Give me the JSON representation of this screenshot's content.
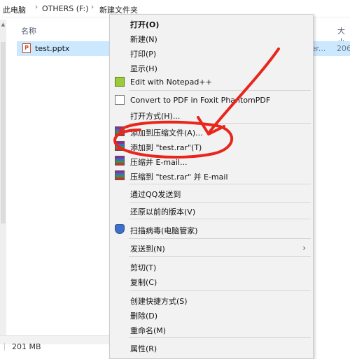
{
  "breadcrumb": [
    "此电脑",
    "OTHERS (F:)",
    "新建文件夹"
  ],
  "columns": {
    "name": "名称",
    "size": "大小"
  },
  "file": {
    "name": "test.pptx",
    "type_partial": "ver...",
    "size_partial": "206"
  },
  "status": {
    "size": "201 MB"
  },
  "context_menu": {
    "open": "打开(O)",
    "new": "新建(N)",
    "print": "打印(P)",
    "show": "显示(H)",
    "notepadpp": "Edit with Notepad++",
    "foxit": "Convert to PDF in Foxit PhantomPDF",
    "open_with": "打开方式(H)...",
    "add_to_archive": "添加到压缩文件(A)...",
    "add_to_rar": "添加到 \"test.rar\"(T)",
    "compress_email": "压缩并 E-mail...",
    "compress_rar_email": "压缩到 \"test.rar\" 并 E-mail",
    "qq_send": "通过QQ发送到",
    "restore_prev": "还原以前的版本(V)",
    "scan_virus": "扫描病毒(电脑管家)",
    "send_to": "发送到(N)",
    "cut": "剪切(T)",
    "copy": "复制(C)",
    "create_shortcut": "创建快捷方式(S)",
    "delete": "删除(D)",
    "rename": "重命名(M)",
    "properties": "属性(R)"
  },
  "annotation": {
    "color": "#e8261c",
    "shape": "hand-drawn arrow circling menu item"
  },
  "icons": {
    "notepadpp": "notepad-plus-plus-icon",
    "foxit": "foxit-pdf-icon",
    "winrar": "winrar-icon",
    "shield": "tencent-shield-icon"
  }
}
